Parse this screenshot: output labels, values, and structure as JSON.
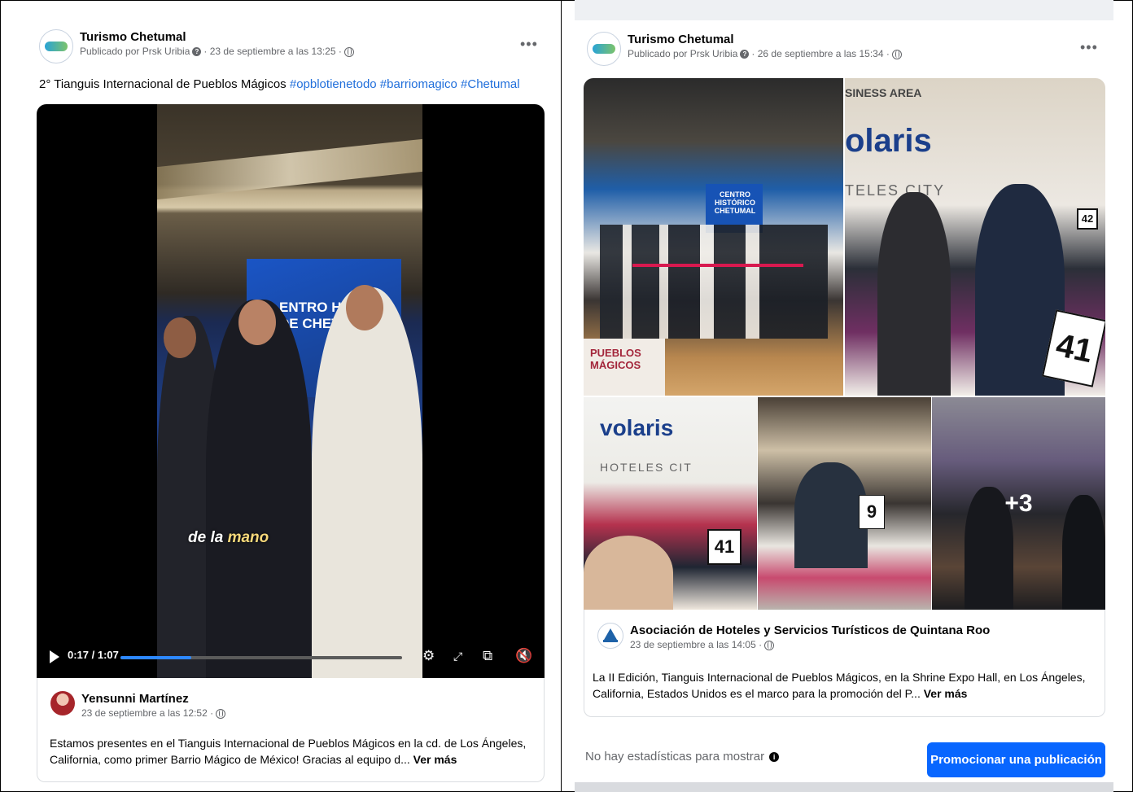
{
  "left_post": {
    "page_name": "Turismo Chetumal",
    "published_by": "Publicado por Prsk Uribia",
    "date": "· 23 de septiembre a las 13:25 ·",
    "more": "•••",
    "text_plain": "2° Tianguis Internacional de Pueblos Mágicos",
    "hashtags": [
      "#opblotienetodo",
      "#barriomagico",
      "#Chetumal"
    ],
    "video": {
      "overlay_sign": "ENTRO HISTÓRI\nDE CHETUMAL",
      "caption_a": "de la",
      "caption_b": "mano",
      "time": "0:17 / 1:07",
      "progress": 0.25
    },
    "shared": {
      "author": "Yensunni Martínez",
      "date": "23 de septiembre a las 12:52 ·",
      "text": "Estamos presentes en el Tianguis Internacional de Pueblos Mágicos en la cd. de Los Ángeles, California, como primer Barrio Mágico de México! Gracias al equipo d...",
      "see_more": "Ver más"
    }
  },
  "right_post": {
    "page_name": "Turismo Chetumal",
    "published_by": "Publicado por Prsk Uribia",
    "date": "· 26 de septiembre a las 15:34 ·",
    "more": "•••",
    "photos": {
      "p1_sign": "CENTRO HISTÓRICO CHETUMAL",
      "p1_pueblos": "PUEBLOS MÁGICOS",
      "p2_brand": "olaris",
      "p2_business": "SINESS AREA",
      "p2_hoteles": "TELES CITY",
      "p2_num": "41",
      "p2_num2": "42",
      "p3_brand": "volaris",
      "p3_hoteles": "HOTELES CIT",
      "p3_num": "41",
      "p4_num": "9",
      "more_count": "+3"
    },
    "shared": {
      "author": "Asociación de Hoteles y Servicios Turísticos de Quintana Roo",
      "date": "23 de septiembre a las 14:05 ·",
      "text": "La II Edición, Tianguis Internacional de Pueblos Mágicos, en la Shrine Expo Hall, en Los Ángeles, California, Estados Unidos es el marco para la promoción del P...",
      "see_more": "Ver más"
    },
    "stats_text": "No hay estadísticas para mostrar",
    "promote_label": "Promocionar una publicación"
  }
}
